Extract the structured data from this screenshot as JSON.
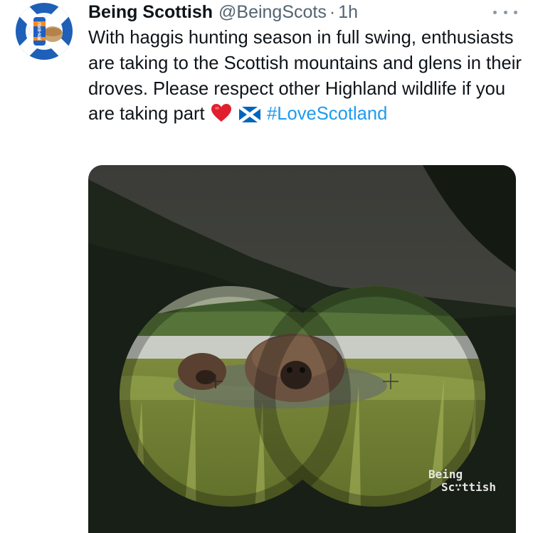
{
  "tweet": {
    "display_name": "Being Scottish",
    "handle": "@BeingScots",
    "separator": "·",
    "time": "1h",
    "text_main": "With haggis hunting season in full swing, enthusiasts are taking to the Scottish mountains and glens in their droves. Please respect other Highland wildlife if you are taking part",
    "hashtag": "#LoveScotland",
    "emojis": [
      "heart-emoji",
      "scotland-flag-emoji"
    ]
  },
  "avatar": {
    "can_label": "IRN-BRU"
  },
  "media": {
    "watermark_line1": "Being",
    "watermark_line2": "Sc∵ttish"
  },
  "colors": {
    "text": "#0f1419",
    "secondary": "#536471",
    "link": "#1d9bf0",
    "saltire_blue": "#0065bd"
  }
}
